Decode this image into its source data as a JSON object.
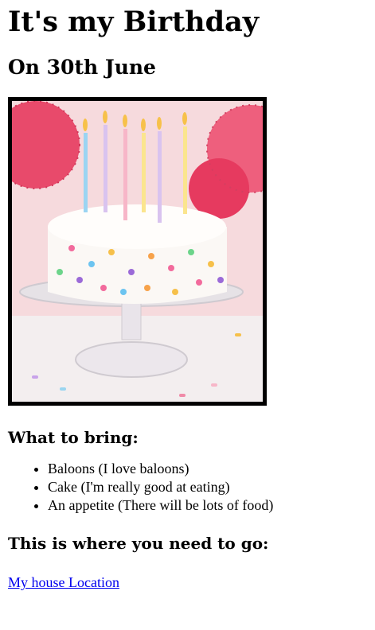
{
  "header": {
    "title": "It's my Birthday",
    "date": "On 30th June"
  },
  "image": {
    "subject": "birthday-cake"
  },
  "bring": {
    "heading": "What to bring:",
    "items": [
      "Baloons (I love baloons)",
      "Cake (I'm really good at eating)",
      "An appetite (There will be lots of food)"
    ]
  },
  "location": {
    "heading": "This is where you need to go:",
    "link_text": "My house Location"
  },
  "colors": {
    "link": "#0000ee",
    "frame": "#000000"
  }
}
